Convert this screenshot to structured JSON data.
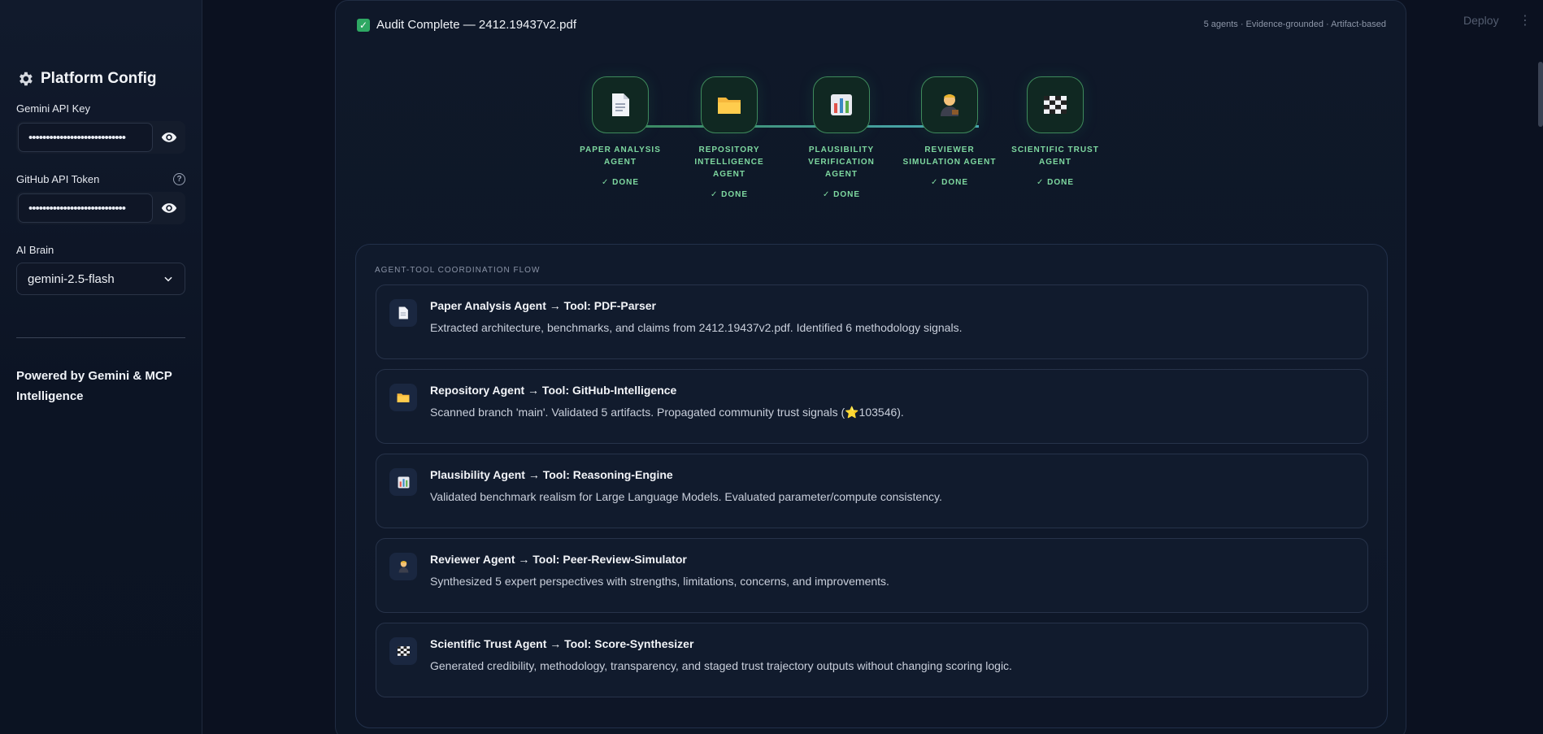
{
  "sidebar": {
    "title": "Platform Config",
    "gemini_label": "Gemini API Key",
    "gemini_value": "••••••••••••••••••••••••••••",
    "github_label": "GitHub API Token",
    "github_value": "••••••••••••••••••••••••••••",
    "brain_label": "AI Brain",
    "brain_value": "gemini-2.5-flash",
    "powered": "Powered by Gemini & MCP Intelligence"
  },
  "topbar": {
    "deploy": "Deploy",
    "menu": "⋮"
  },
  "audit": {
    "title": "Audit Complete — 2412.19437v2.pdf",
    "meta": "5 agents · Evidence-grounded · Artifact-based"
  },
  "pipeline": [
    {
      "name": "Paper Analysis Agent",
      "status": "✓ DONE",
      "icon": "document-icon"
    },
    {
      "name": "Repository Intelligence Agent",
      "status": "✓ DONE",
      "icon": "folder-icon"
    },
    {
      "name": "Plausibility Verification Agent",
      "status": "✓ DONE",
      "icon": "bar-chart-icon"
    },
    {
      "name": "Reviewer Simulation Agent",
      "status": "✓ DONE",
      "icon": "reviewer-icon"
    },
    {
      "name": "Scientific Trust Agent",
      "status": "✓ DONE",
      "icon": "checkered-flag-icon"
    }
  ],
  "flow": {
    "label": "AGENT-TOOL COORDINATION FLOW",
    "items": [
      {
        "title": "Paper Analysis Agent → Tool: PDF-Parser",
        "desc": "Extracted architecture, benchmarks, and claims from 2412.19437v2.pdf. Identified 6 methodology signals.",
        "icon": "document-icon"
      },
      {
        "title": "Repository Agent → Tool: GitHub-Intelligence",
        "desc": "Scanned branch 'main'. Validated 5 artifacts. Propagated community trust signals (⭐103546).",
        "icon": "folder-icon"
      },
      {
        "title": "Plausibility Agent → Tool: Reasoning-Engine",
        "desc": "Validated benchmark realism for Large Language Models. Evaluated parameter/compute consistency.",
        "icon": "bar-chart-icon"
      },
      {
        "title": "Reviewer Agent → Tool: Peer-Review-Simulator",
        "desc": "Synthesized 5 expert perspectives with strengths, limitations, concerns, and improvements.",
        "icon": "reviewer-icon"
      },
      {
        "title": "Scientific Trust Agent → Tool: Score-Synthesizer",
        "desc": "Generated credibility, methodology, transparency, and staged trust trajectory outputs without changing scoring logic.",
        "icon": "checkered-flag-icon"
      }
    ]
  }
}
